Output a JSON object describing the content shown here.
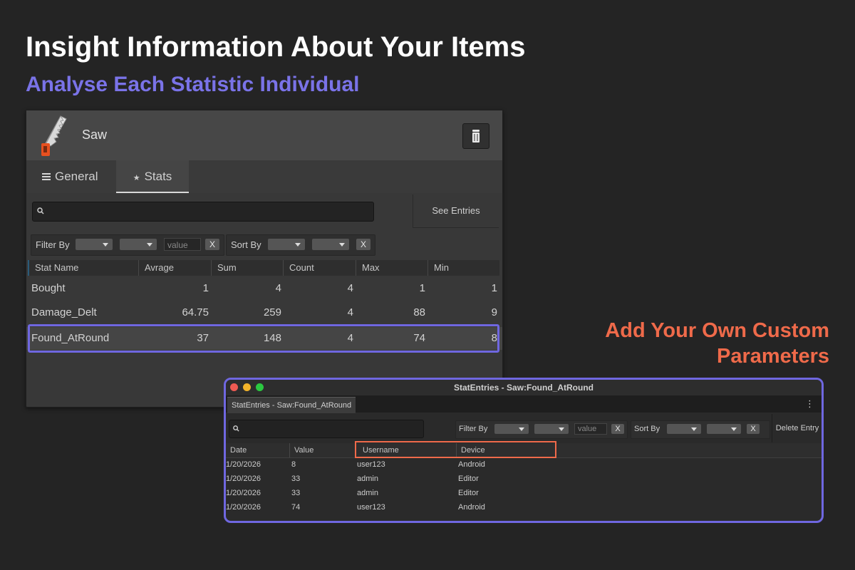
{
  "headline": "Insight Information About Your Items",
  "subheadline": "Analyse Each Statistic Individual",
  "custom_params_title": [
    "Add Your Own Custom",
    "Parameters"
  ],
  "colors": {
    "accent_purple": "#6f67e0",
    "accent_orange": "#ef6a4a",
    "background": "#242424"
  },
  "item_panel": {
    "item_name": "Saw",
    "item_icon": "saw-icon",
    "delete_icon": "trash-icon",
    "tabs": [
      {
        "label": "General",
        "icon": "list-icon"
      },
      {
        "label": "Stats",
        "icon": "star-icon",
        "active": true
      }
    ],
    "search_value": "",
    "see_entries_label": "See Entries",
    "filter": {
      "label": "Filter By",
      "value_placeholder": "value",
      "clear_label": "X"
    },
    "sort": {
      "label": "Sort By",
      "clear_label": "X"
    },
    "columns": [
      "Stat Name",
      "Avrage",
      "Sum",
      "Count",
      "Max",
      "Min"
    ],
    "rows": [
      {
        "name": "Bought",
        "average": "1",
        "sum": "4",
        "count": "4",
        "max": "1",
        "min": "1"
      },
      {
        "name": "Damage_Delt",
        "average": "64.75",
        "sum": "259",
        "count": "4",
        "max": "88",
        "min": "9"
      },
      {
        "name": "Found_AtRound",
        "average": "37",
        "sum": "148",
        "count": "4",
        "max": "74",
        "min": "8",
        "highlighted": true
      }
    ]
  },
  "entries_window": {
    "title": "StatEntries - Saw:Found_AtRound",
    "tab_label": "StatEntries - Saw:Found_AtRound",
    "menu_icon": "kebab-icon",
    "filter": {
      "label": "Filter By",
      "value_placeholder": "value",
      "clear_label": "X"
    },
    "sort": {
      "label": "Sort By",
      "clear_label": "X"
    },
    "delete_label": "Delete Entry",
    "columns": [
      "Date",
      "Value",
      "Username",
      "Device"
    ],
    "rows": [
      {
        "date": "1/20/2026",
        "value": "8",
        "username": "user123",
        "device": "Android"
      },
      {
        "date": "1/20/2026",
        "value": "33",
        "username": "admin",
        "device": "Editor"
      },
      {
        "date": "1/20/2026",
        "value": "33",
        "username": "admin",
        "device": "Editor"
      },
      {
        "date": "1/20/2026",
        "value": "74",
        "username": "user123",
        "device": "Android"
      }
    ]
  }
}
